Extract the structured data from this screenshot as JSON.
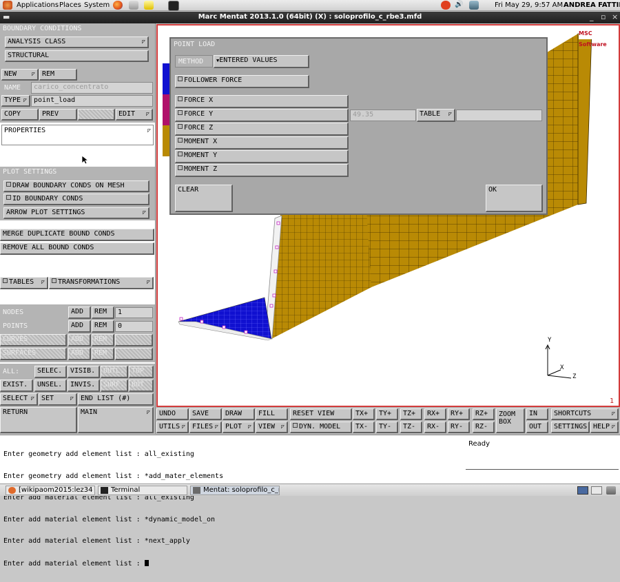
{
  "topbar": {
    "menus": [
      "Applications",
      "Places",
      "System"
    ],
    "datetime": "Fri May 29,  9:57 AM",
    "user": "ANDREA FATTINI"
  },
  "window": {
    "title": "Marc Mentat 2013.1.0 (64bit) (X) : soloprofilo_c_rbe3.mfd",
    "controls": [
      "_",
      "▫",
      "×"
    ]
  },
  "left": {
    "boundary_header": "BOUNDARY CONDITIONS",
    "analysis_class": "ANALYSIS CLASS",
    "structural": "STRUCTURAL",
    "new": "NEW",
    "rem": "REM",
    "name_label": "NAME",
    "name_value": "carico_concentrato",
    "type_label": "TYPE",
    "type_value": "point_load",
    "copy": "COPY",
    "prev": "PREV",
    "edit": "EDIT",
    "properties": "PROPERTIES",
    "plot_header": "PLOT SETTINGS",
    "draw_bc": "DRAW BOUNDARY CONDS ON MESH",
    "id_bc": "ID BOUNDARY CONDS",
    "arrow_plot": "ARROW PLOT SETTINGS",
    "merge": "MERGE DUPLICATE BOUND CONDS",
    "remove_all": "REMOVE ALL BOUND CONDS",
    "tables": "TABLES",
    "transformations": "TRANSFORMATIONS",
    "nodes": "NODES",
    "points": "POINTS",
    "curves": "CURVES",
    "surfaces": "SURFACES",
    "add": "ADD",
    "rem2": "REM",
    "nodes_count": "1",
    "points_count": "0",
    "all": "ALL:",
    "selec": "SELEC.",
    "visib": "VISIB.",
    "outl": "OUTL.",
    "top": "TOP",
    "exist": "EXIST.",
    "unsel": "UNSEL.",
    "invis": "INVIS.",
    "surf": "SURF.",
    "bot": "BOT",
    "select": "SELECT",
    "set": "SET",
    "end_list": "END LIST (#)",
    "return": "RETURN",
    "main": "MAIN"
  },
  "dialog": {
    "title": "POINT LOAD",
    "method_label": "METHOD",
    "method_value": "ENTERED VALUES",
    "follower_force": "FOLLOWER FORCE",
    "force_x": "FORCE X",
    "force_y": "FORCE Y",
    "force_y_value": "49.35",
    "table": "TABLE",
    "force_z": "FORCE Z",
    "moment_x": "MOMENT X",
    "moment_y": "MOMENT Y",
    "moment_z": "MOMENT Z",
    "clear": "CLEAR",
    "ok": "OK"
  },
  "viewport": {
    "logo": "MSC Software",
    "axis_x": "X",
    "axis_y": "Y",
    "axis_z": "Z",
    "view_number": "1",
    "mesh_color": "#b98a05",
    "fixed_color": "#1010d0"
  },
  "toolbar": {
    "undo": "UNDO",
    "save": "SAVE",
    "draw": "DRAW",
    "fill": "FILL",
    "reset_view": "RESET VIEW",
    "tx_plus": "TX+",
    "ty_plus": "TY+",
    "tz_plus": "TZ+",
    "rx_plus": "RX+",
    "ry_plus": "RY+",
    "rz_plus": "RZ+",
    "zoom_box": "ZOOM BOX",
    "in": "IN",
    "shortcuts": "SHORTCUTS",
    "utils": "UTILS",
    "files": "FILES",
    "plot": "PLOT",
    "view": "VIEW",
    "dyn_model": "DYN. MODEL",
    "tx_minus": "TX-",
    "ty_minus": "TY-",
    "tz_minus": "TZ-",
    "rx_minus": "RX-",
    "ry_minus": "RY-",
    "rz_minus": "RZ-",
    "out": "OUT",
    "settings": "SETTINGS",
    "help": "HELP"
  },
  "console": {
    "lines": [
      "Enter geometry add element list : all_existing",
      "Enter geometry add element list : *add_mater_elements",
      "Enter add material element list : all_existing",
      "Enter add material element list : *dynamic_model_on",
      "Enter add material element list : *next_apply",
      "Enter add material element list : "
    ],
    "status": "Ready"
  },
  "taskbar": {
    "items": [
      "[wikipaom2015:lez34 ...",
      "Terminal",
      "Mentat: soloprofilo_c_r..."
    ]
  }
}
